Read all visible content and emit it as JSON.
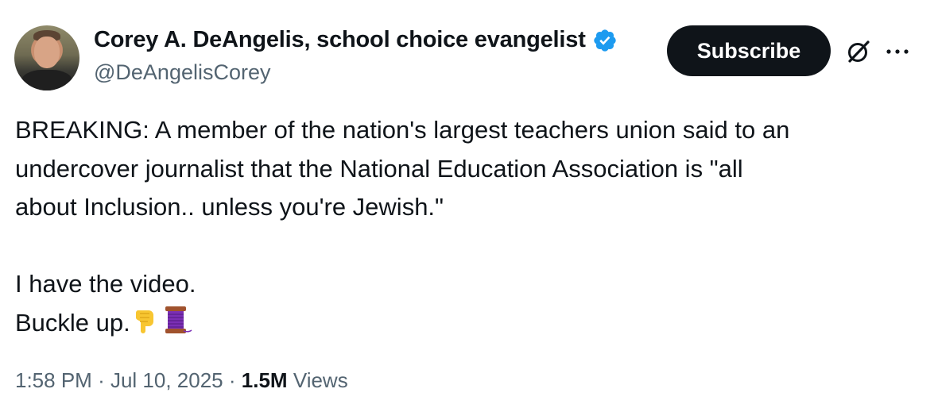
{
  "author": {
    "display_name": "Corey A. DeAngelis, school choice evangelist",
    "handle": "@DeAngelisCorey",
    "verified": true,
    "verified_color": "#1d9bf0"
  },
  "actions": {
    "subscribe_label": "Subscribe",
    "grok_icon": "grok-icon",
    "more_icon": "more-options-icon"
  },
  "tweet": {
    "lines": [
      "BREAKING: A member of the nation's largest teachers union said to an",
      "undercover journalist that the National Education Association is \"all",
      "about Inclusion.. unless you're Jewish.\"",
      "I have the video.",
      "Buckle up."
    ],
    "emojis": [
      "backhand-index-pointing-down",
      "spool-of-thread"
    ]
  },
  "meta": {
    "time": "1:58 PM",
    "separator": "·",
    "date": "Jul 10, 2025",
    "views_count": "1.5M",
    "views_label": "Views"
  },
  "colors": {
    "text_primary": "#0f1419",
    "text_secondary": "#536471",
    "button_bg": "#0f1419"
  }
}
